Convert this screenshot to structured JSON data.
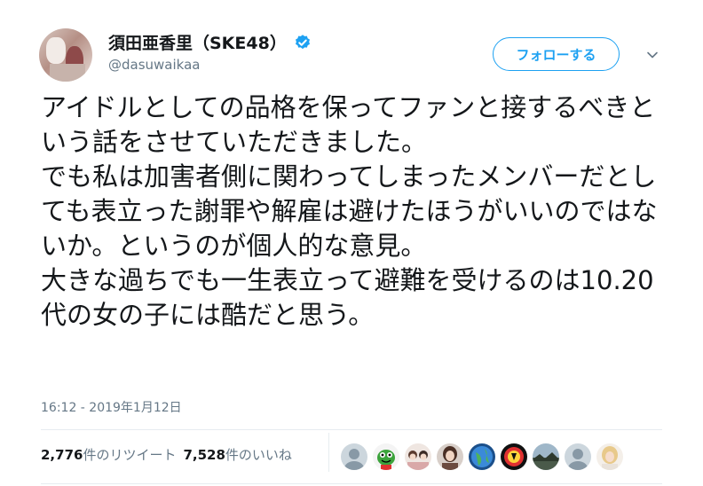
{
  "user": {
    "display_name": "須田亜香里（SKE48）",
    "handle": "@dasuwaikaa",
    "verified": true,
    "avatar_icon": "profile-photo"
  },
  "follow_button": {
    "label": "フォローする"
  },
  "more_menu": {
    "icon": "chevron-down-icon"
  },
  "tweet": {
    "text": "アイドルとしての品格を保ってファンと接するべきという話をさせていただきました。\nでも私は加害者側に関わってしまったメンバーだとしても表立った謝罪や解雇は避けたほうがいいのではないか。というのが個人的な意見。\n大きな過ちでも一生表立って避難を受けるのは10.20代の女の子には酷だと思う。",
    "timestamp": "16:12 - 2019年1月12日"
  },
  "stats": {
    "retweet_count": "2,776",
    "retweet_label": "件のリツイート",
    "like_count": "7,528",
    "like_label": "件のいいね"
  },
  "likers": [
    {
      "icon": "default-avatar-icon"
    },
    {
      "icon": "frog-character-avatar-icon"
    },
    {
      "icon": "group-photo-avatar-icon"
    },
    {
      "icon": "person-photo-avatar-icon"
    },
    {
      "icon": "globe-avatar-icon"
    },
    {
      "icon": "sports-logo-avatar-icon"
    },
    {
      "icon": "landscape-avatar-icon"
    },
    {
      "icon": "default-avatar-icon"
    },
    {
      "icon": "blonde-person-avatar-icon"
    }
  ],
  "colors": {
    "accent": "#1da1f2",
    "text_primary": "#14171a",
    "text_secondary": "#657786",
    "divider": "#e6ecf0"
  }
}
